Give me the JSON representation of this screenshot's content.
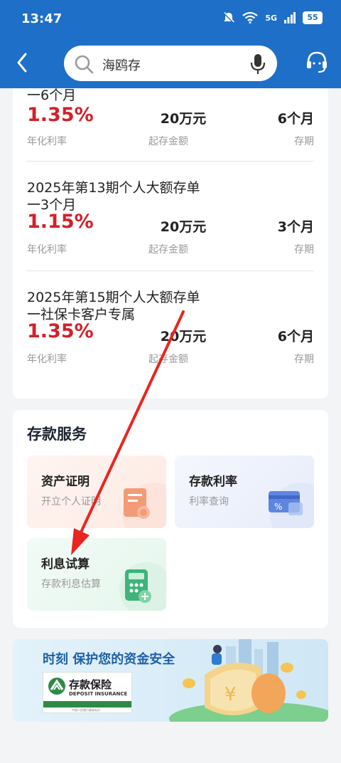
{
  "status_bar": {
    "time": "13:47",
    "network": "5G",
    "battery": "55"
  },
  "header": {
    "search_query": "海鸥存"
  },
  "products": [
    {
      "name_line1": "",
      "name_line2": "一6个月",
      "rate": "1.35%",
      "rate_label": "年化利率",
      "min_amount": "20万元",
      "min_label": "起存金额",
      "term": "6个月",
      "term_label": "存期"
    },
    {
      "name_line1": "2025年第13期个人大额存单",
      "name_line2": "一3个月",
      "rate": "1.15%",
      "rate_label": "年化利率",
      "min_amount": "20万元",
      "min_label": "起存金额",
      "term": "3个月",
      "term_label": "存期"
    },
    {
      "name_line1": "2025年第15期个人大额存单",
      "name_line2": "一社保卡客户专属",
      "rate": "1.35%",
      "rate_label": "年化利率",
      "min_amount": "20万元",
      "min_label": "起存金额",
      "term": "6个月",
      "term_label": "存期"
    }
  ],
  "services": {
    "title": "存款服务",
    "tiles": [
      {
        "title": "资产证明",
        "subtitle": "开立个人证明"
      },
      {
        "title": "存款利率",
        "subtitle": "利率查询"
      },
      {
        "title": "利息试算",
        "subtitle": "存款利息估算"
      }
    ]
  },
  "banner": {
    "slogan": "时刻 保护您的资金安全",
    "logo_zh": "存款保险",
    "logo_en": "DEPOSIT INSURANCE",
    "logo_foot": "中国人民银行颁发标识"
  },
  "colors": {
    "brand_blue": "#1e6fc7",
    "rate_red": "#d32029",
    "annotation_arrow": "#e8261f"
  }
}
